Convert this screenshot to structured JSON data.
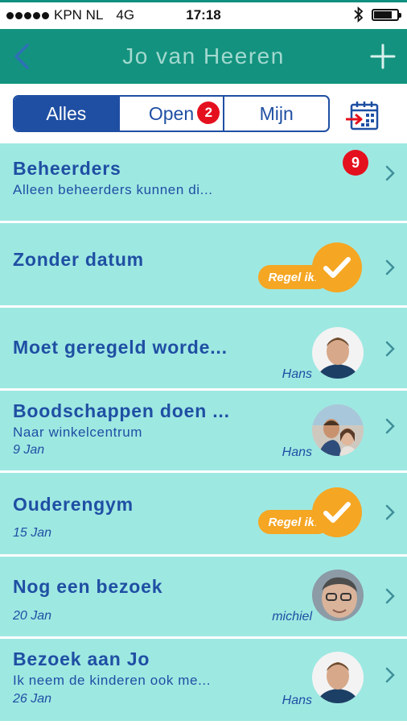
{
  "status_bar": {
    "carrier": "KPN NL",
    "network": "4G",
    "time": "17:18",
    "battery_level": 0.85
  },
  "nav": {
    "title": "Jo van Heeren",
    "back_icon": "chevron-left-icon",
    "add_icon": "plus-icon"
  },
  "filter": {
    "tabs": [
      {
        "label": "Alles",
        "active": true
      },
      {
        "label": "Open",
        "badge": "2"
      },
      {
        "label": "Mijn"
      }
    ],
    "calendar_icon": "calendar-export-icon"
  },
  "colors": {
    "navbar": "#13937f",
    "accent": "#1f4fa3",
    "row": "#9ee8e2",
    "badge": "#e5101e",
    "regel": "#f5a623"
  },
  "rows": [
    {
      "title": "Beheerders",
      "subtitle": "Alleen beheerders kunnen di...",
      "badge": "9"
    },
    {
      "title": "Zonder datum",
      "action": "Regel ik!"
    },
    {
      "title": "Moet geregeld worde...",
      "person": "Hans"
    },
    {
      "title": "Boodschappen doen ...",
      "subtitle": "Naar winkelcentrum",
      "date": "9 Jan",
      "person": "Hans"
    },
    {
      "title": "Ouderengym",
      "date": "15 Jan",
      "action": "Regel ik!"
    },
    {
      "title": "Nog een bezoek",
      "date": "20 Jan",
      "person": "michiel"
    },
    {
      "title": "Bezoek aan Jo",
      "subtitle": "Ik neem de kinderen ook me...",
      "date": "26 Jan",
      "person": "Hans"
    }
  ]
}
